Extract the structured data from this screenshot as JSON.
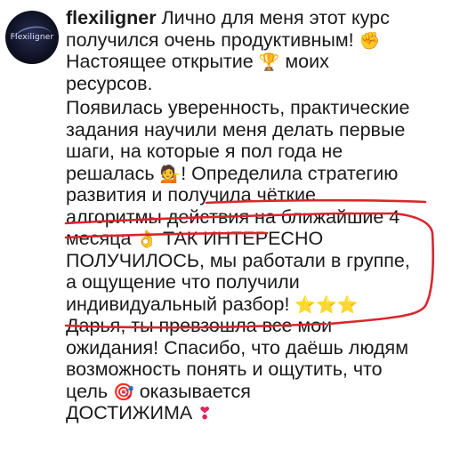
{
  "post": {
    "avatar_logo": "Flexiligner",
    "username": "flexiligner",
    "lines": [
      " Лично для меня этот курс",
      "получился очень продуктивным! ",
      "Настоящее открытие ",
      " моих",
      "ресурсов.",
      "Появилась уверенность, практические",
      "задания научили меня делать первые",
      "шаги, на которые я пол года не",
      "решалась ",
      "! Определила стратегию",
      "развития и получила чёткие",
      "алгоритмы действия на ближайшие 4",
      "месяца ",
      " ТАК ИНТЕРЕСНО",
      "ПОЛУЧИЛОСЬ, мы работали в группе,",
      "а ощущение что получили",
      "индивидуальный разбор! ",
      "Дарья, ты превзошла все мои",
      "ожидания! Спасибо, что даёшь людям",
      "возможность понять и ощутить, что",
      "цель ",
      " оказывается",
      "ДОСТИЖИМА "
    ],
    "emojis": {
      "fist": "✊",
      "trophy": "🏆",
      "person": "💁",
      "ok_hand": "👌",
      "stars": "⭐⭐⭐",
      "target": "🎯",
      "heart": "❣"
    }
  },
  "colors": {
    "text": "#1a1a1a",
    "annotation": "#d8272d",
    "emoji_yellow": "#f4c430"
  }
}
